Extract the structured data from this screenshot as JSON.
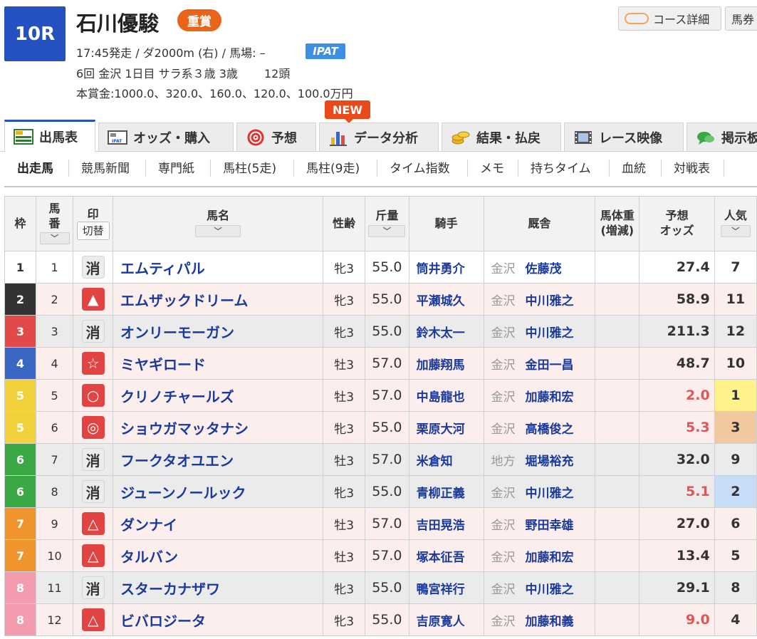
{
  "race": {
    "number": "10R",
    "name": "石川優駿",
    "grade": "重賞",
    "meta": "17:45発走 / ダ2000m (右) / 馬場: –",
    "ipat": "IPAT",
    "info": "6回 金沢 1日目 サラ系３歳 3歳　　 12頭",
    "prize": "本賞金:1000.0、320.0、160.0、120.0、100.0万円"
  },
  "header_buttons": {
    "course": "コース詳細",
    "baken": "馬券"
  },
  "new_badge": "NEW",
  "main_tabs": [
    {
      "label": "出馬表",
      "icon": "table-icon"
    },
    {
      "label": "オッズ・購入",
      "icon": "ipat-card-icon"
    },
    {
      "label": "予想",
      "icon": "target-icon"
    },
    {
      "label": "データ分析",
      "icon": "bar-chart-icon"
    },
    {
      "label": "結果・払戻",
      "icon": "coins-icon"
    },
    {
      "label": "レース映像",
      "icon": "film-icon"
    },
    {
      "label": "掲示板",
      "icon": "chat-icon"
    }
  ],
  "sub_tabs": [
    "出走馬",
    "競馬新聞",
    "専門紙",
    "馬柱(5走)",
    "馬柱(9走)",
    "タイム指数",
    "メモ",
    "持ちタイム",
    "血統",
    "対戦表"
  ],
  "table": {
    "headers": {
      "waku": "枠",
      "umaban": "馬\n番",
      "mark": "印",
      "mark_toggle": "切替",
      "horse": "馬名",
      "sex_age": "性齢",
      "weight": "斤量",
      "jockey": "騎手",
      "stable": "厩舎",
      "body_weight": "馬体重\n(増減)",
      "odds": "予想\nオッズ",
      "popularity": "人気"
    },
    "sort_arrow": "﹀",
    "rows": [
      {
        "waku": "1",
        "umaban": "1",
        "mark": "消",
        "horse": "エムティパル",
        "sex_age": "牝3",
        "weight": "55.0",
        "jockey": "筒井勇介",
        "region": "金沢",
        "trainer": "佐藤茂",
        "body": "",
        "odds": "27.4",
        "pop": "7"
      },
      {
        "waku": "2",
        "umaban": "2",
        "mark": "▲",
        "horse": "エムザックドリーム",
        "sex_age": "牝3",
        "weight": "55.0",
        "jockey": "平瀬城久",
        "region": "金沢",
        "trainer": "中川雅之",
        "body": "",
        "odds": "58.9",
        "pop": "11"
      },
      {
        "waku": "3",
        "umaban": "3",
        "mark": "消",
        "horse": "オンリーモーガン",
        "sex_age": "牝3",
        "weight": "55.0",
        "jockey": "鈴木太一",
        "region": "金沢",
        "trainer": "中川雅之",
        "body": "",
        "odds": "211.3",
        "pop": "12"
      },
      {
        "waku": "4",
        "umaban": "4",
        "mark": "☆",
        "horse": "ミヤギロード",
        "sex_age": "牡3",
        "weight": "57.0",
        "jockey": "加藤翔馬",
        "region": "金沢",
        "trainer": "金田一昌",
        "body": "",
        "odds": "48.7",
        "pop": "10"
      },
      {
        "waku": "5",
        "umaban": "5",
        "mark": "○",
        "horse": "クリノチャールズ",
        "sex_age": "牡3",
        "weight": "57.0",
        "jockey": "中島龍也",
        "region": "金沢",
        "trainer": "加藤和宏",
        "body": "",
        "odds": "2.0",
        "pop": "1"
      },
      {
        "waku": "5",
        "umaban": "6",
        "mark": "◎",
        "horse": "ショウガマッタナシ",
        "sex_age": "牝3",
        "weight": "55.0",
        "jockey": "栗原大河",
        "region": "金沢",
        "trainer": "高橋俊之",
        "body": "",
        "odds": "5.3",
        "pop": "3"
      },
      {
        "waku": "6",
        "umaban": "7",
        "mark": "消",
        "horse": "フークタオユエン",
        "sex_age": "牡3",
        "weight": "57.0",
        "jockey": "米倉知",
        "region": "地方",
        "trainer": "堀場裕充",
        "body": "",
        "odds": "32.0",
        "pop": "9"
      },
      {
        "waku": "6",
        "umaban": "8",
        "mark": "消",
        "horse": "ジューンノールック",
        "sex_age": "牝3",
        "weight": "55.0",
        "jockey": "青柳正義",
        "region": "金沢",
        "trainer": "中川雅之",
        "body": "",
        "odds": "5.1",
        "pop": "2"
      },
      {
        "waku": "7",
        "umaban": "9",
        "mark": "△",
        "horse": "ダンナイ",
        "sex_age": "牡3",
        "weight": "57.0",
        "jockey": "吉田晃浩",
        "region": "金沢",
        "trainer": "野田幸雄",
        "body": "",
        "odds": "27.0",
        "pop": "6"
      },
      {
        "waku": "7",
        "umaban": "10",
        "mark": "△",
        "horse": "タルバン",
        "sex_age": "牡3",
        "weight": "57.0",
        "jockey": "塚本征吾",
        "region": "金沢",
        "trainer": "加藤和宏",
        "body": "",
        "odds": "13.4",
        "pop": "5"
      },
      {
        "waku": "8",
        "umaban": "11",
        "mark": "消",
        "horse": "スターカナザワ",
        "sex_age": "牝3",
        "weight": "55.0",
        "jockey": "鴨宮祥行",
        "region": "金沢",
        "trainer": "中川雅之",
        "body": "",
        "odds": "29.1",
        "pop": "8"
      },
      {
        "waku": "8",
        "umaban": "12",
        "mark": "△",
        "horse": "ビバロジータ",
        "sex_age": "牝3",
        "weight": "55.0",
        "jockey": "吉原寛人",
        "region": "金沢",
        "trainer": "加藤和義",
        "body": "",
        "odds": "9.0",
        "pop": "4"
      }
    ]
  },
  "colors": {
    "race_badge": "#2450c0",
    "grade_badge": "#e8641b",
    "link": "#1a3a9c",
    "low_odds": "#e05555",
    "pop1": "#fff28a",
    "pop2": "#c6dcf7",
    "pop3": "#f2c8a0",
    "waku": {
      "1": {
        "bg": "#ffffff",
        "fg": "#333333"
      },
      "2": {
        "bg": "#333333",
        "fg": "#ffffff"
      },
      "3": {
        "bg": "#e24a4a",
        "fg": "#ffffff"
      },
      "4": {
        "bg": "#3a66c4",
        "fg": "#ffffff"
      },
      "5": {
        "bg": "#f2d23b",
        "fg": "#ffffff"
      },
      "6": {
        "bg": "#3aa845",
        "fg": "#ffffff"
      },
      "7": {
        "bg": "#f0952e",
        "fg": "#ffffff"
      },
      "8": {
        "bg": "#f49bb0",
        "fg": "#ffffff"
      }
    }
  }
}
